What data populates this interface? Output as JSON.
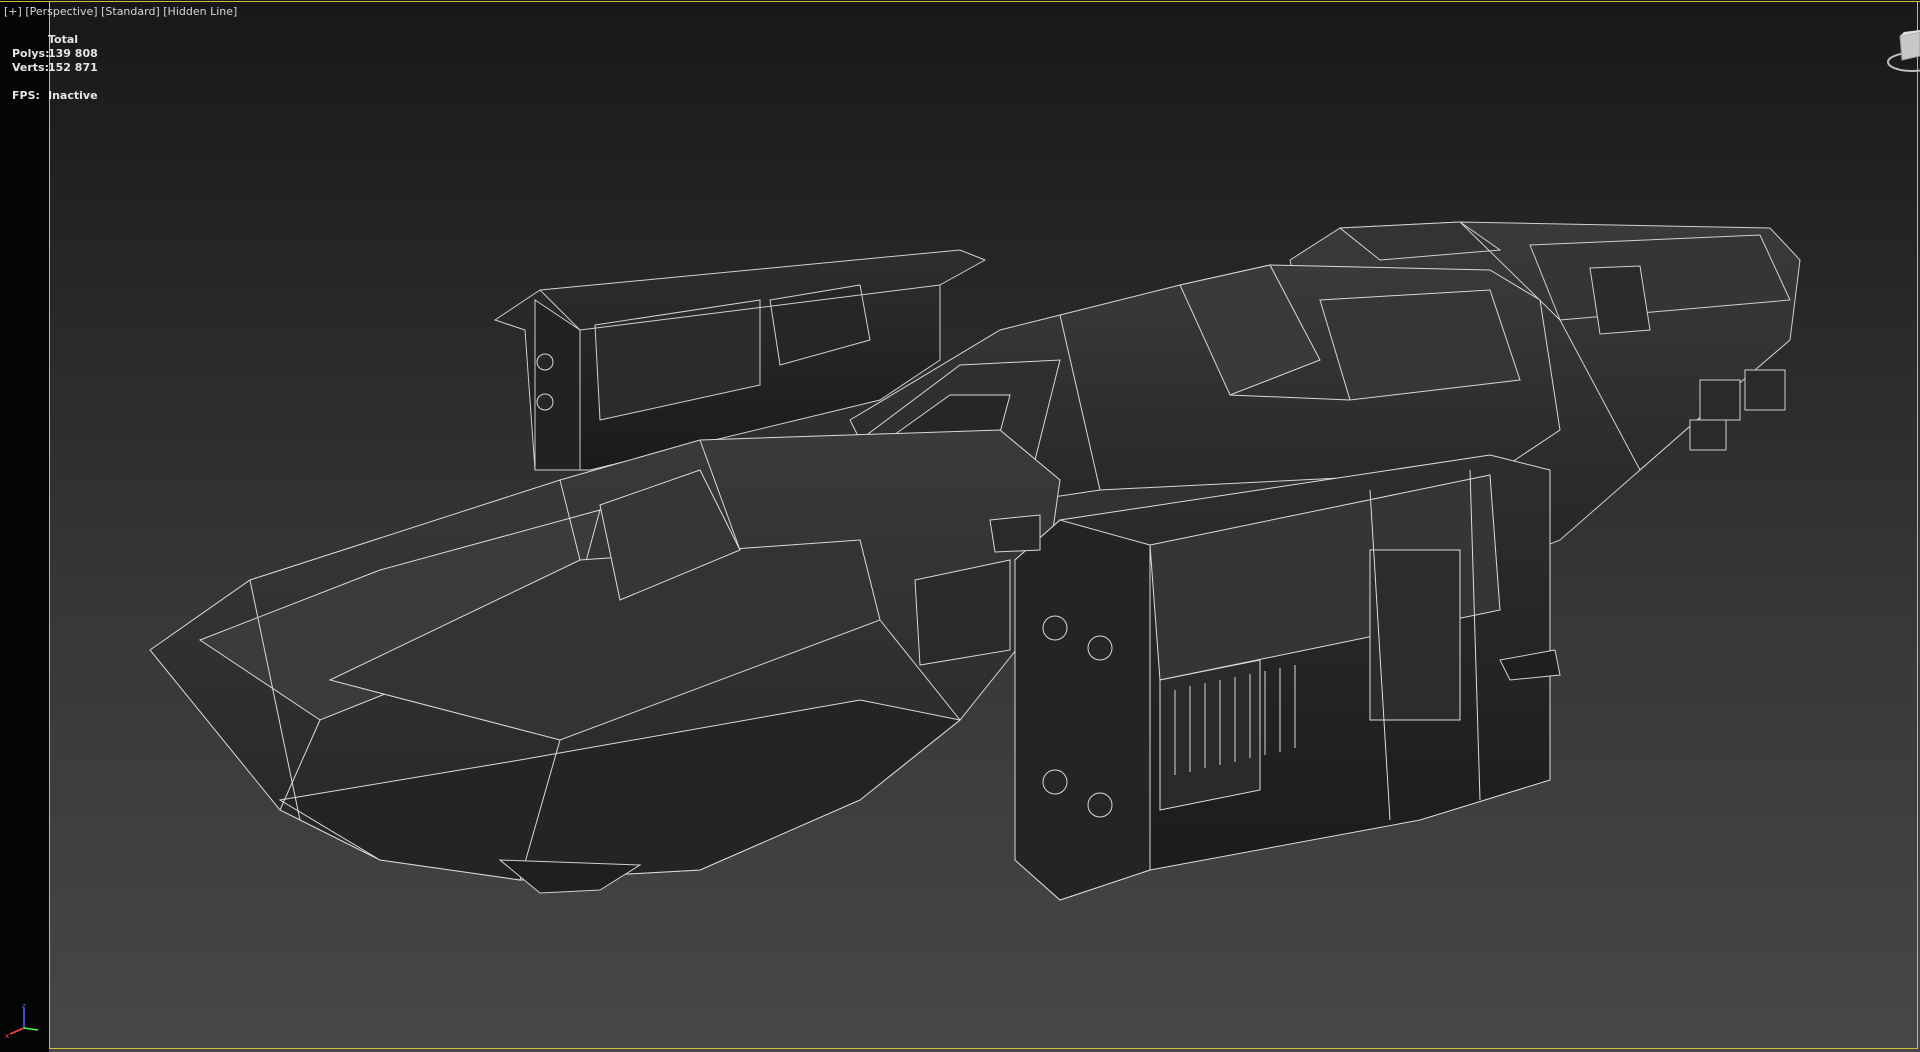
{
  "viewport": {
    "label_parts": [
      "[+]",
      "[Perspective]",
      "[Standard]",
      "[Hidden Line]"
    ]
  },
  "stats": {
    "header": "Total",
    "polys_label": "Polys:",
    "polys_value": "139 808",
    "verts_label": "Verts:",
    "verts_value": "152 871",
    "fps_label": "FPS:",
    "fps_value": "Inactive"
  },
  "icons": {
    "viewcube": "viewcube-icon",
    "axis": "axis-tripod-icon"
  },
  "colors": {
    "active_border": "#c9c23a",
    "wire": "#d8d8d8",
    "surface": "#303030"
  }
}
